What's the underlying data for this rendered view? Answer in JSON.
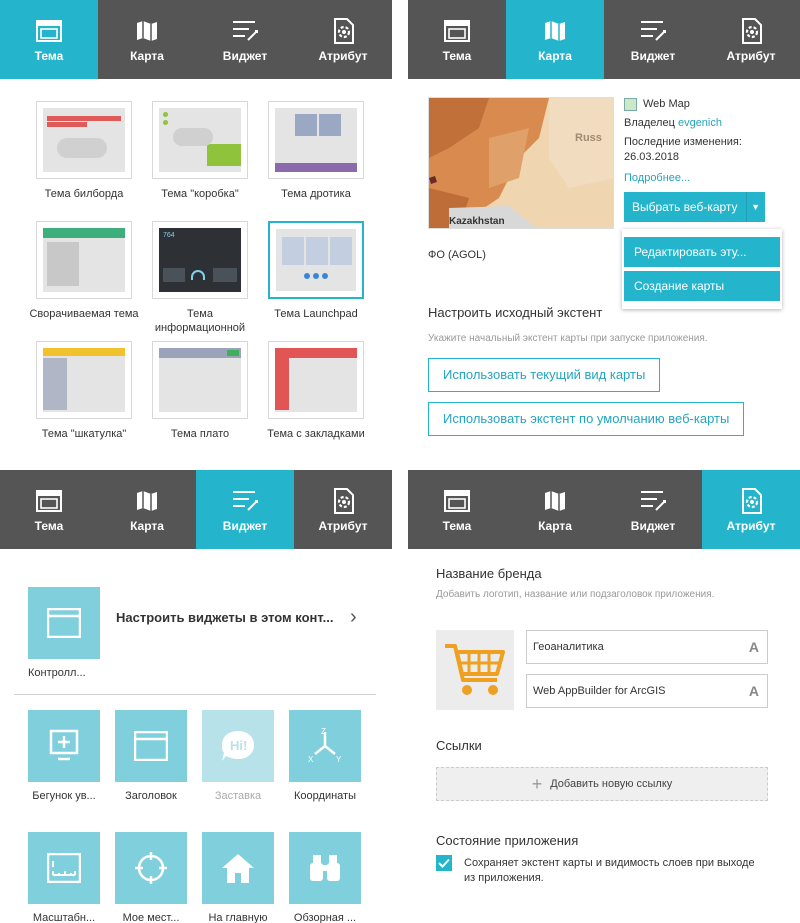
{
  "tabs": {
    "theme": "Тема",
    "map": "Карта",
    "widget": "Виджет",
    "attribute": "Атрибут"
  },
  "theme_panel": {
    "themes": [
      {
        "label": "Тема билборда"
      },
      {
        "label": "Тема \"коробка\""
      },
      {
        "label": "Тема дротика"
      },
      {
        "label": "Сворачиваемая тема"
      },
      {
        "label": "Тема информационной",
        "badge": "764"
      },
      {
        "label": "Тема Launchpad",
        "selected": true
      },
      {
        "label": "Тема \"шкатулка\""
      },
      {
        "label": "Тема плато"
      },
      {
        "label": "Тема с закладками"
      }
    ]
  },
  "map_panel": {
    "thumb_labels": [
      "Russ",
      "Kazakhstan"
    ],
    "map_type": "Web Map",
    "owner_label": "Владелец",
    "owner": "evgenich",
    "modified_label": "Последние изменения:",
    "modified_date": "26.03.2018",
    "more_link": "Подробнее...",
    "select_button": "Выбрать веб-карту",
    "dropdown": [
      "Редактировать эту...",
      "Создание карты"
    ],
    "map_name": "ФО (AGOL)",
    "extent_title": "Настроить исходный экстент",
    "extent_hint": "Укажите начальный экстент карты при запуске приложения.",
    "btn_current": "Использовать текущий вид карты",
    "btn_default": "Использовать экстент по умолчанию веб-карты"
  },
  "widget_panel": {
    "controller_label": "Настроить виджеты в этом конт...",
    "controller_name": "Контролл...",
    "widgets": [
      {
        "label": "Бегунок ув...",
        "icon": "zoom-slider-icon"
      },
      {
        "label": "Заголовок",
        "icon": "header-icon"
      },
      {
        "label": "Заставка",
        "icon": "splash-icon",
        "faded": true
      },
      {
        "label": "Координаты",
        "icon": "coordinate-icon"
      },
      {
        "label": "Масштабн...",
        "icon": "scalebar-icon"
      },
      {
        "label": "Мое мест...",
        "icon": "my-location-icon"
      },
      {
        "label": "На главную",
        "icon": "home-icon"
      },
      {
        "label": "Обзорная ...",
        "icon": "overview-icon"
      }
    ]
  },
  "attribute_panel": {
    "brand_title": "Название бренда",
    "brand_hint": "Добавить логотип, название или подзаголовок приложения.",
    "title_value": "Геоаналитика",
    "subtitle_value": "Web AppBuilder for ArcGIS",
    "font_glyph": "A",
    "links_title": "Ссылки",
    "add_link": "Добавить новую ссылку",
    "state_title": "Состояние приложения",
    "state_text": "Сохраняет экстент карты и видимость слоев при выходе из приложения."
  },
  "colors": {
    "accent": "#24b5cc",
    "tabbar": "#555555"
  }
}
